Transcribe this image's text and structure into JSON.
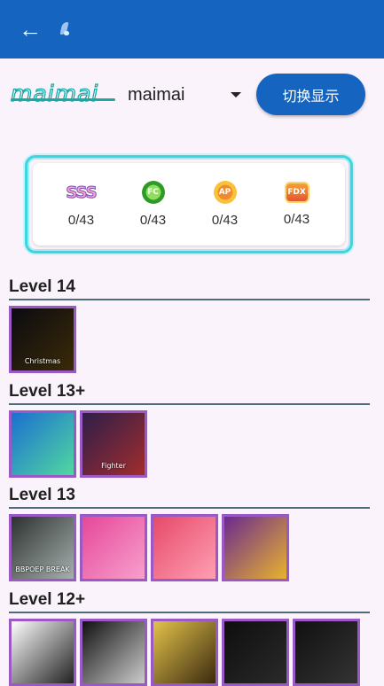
{
  "app_bar": {
    "back_icon": "arrow-left-icon",
    "app_icon": "app-logo-icon",
    "color": "#1565c0"
  },
  "header": {
    "logo_text": "maimai",
    "game_select_value": "maimai",
    "switch_button_label": "切换显示"
  },
  "stats": [
    {
      "badge": "SSS",
      "count": "0/43"
    },
    {
      "badge": "FC",
      "count": "0/43"
    },
    {
      "badge": "AP",
      "count": "0/43"
    },
    {
      "badge": "FDX",
      "count": "0/43"
    }
  ],
  "levels": [
    {
      "title": "Level 14",
      "covers": [
        {
          "label": "Christmas",
          "colors": [
            "#0b0b10",
            "#3a2a08"
          ]
        }
      ]
    },
    {
      "title": "Level 13+",
      "covers": [
        {
          "label": "",
          "colors": [
            "#1b6fd1",
            "#51d8a0"
          ]
        },
        {
          "label": "Fighter",
          "colors": [
            "#2e1e4a",
            "#a12d2d"
          ]
        }
      ]
    },
    {
      "title": "Level 13",
      "covers": [
        {
          "label": "BBPOEP BREAK",
          "colors": [
            "#2d3230",
            "#a6b0ae"
          ]
        },
        {
          "label": "",
          "colors": [
            "#e6479a",
            "#f7a0cc"
          ]
        },
        {
          "label": "",
          "colors": [
            "#e64a6a",
            "#ff9fb3"
          ]
        },
        {
          "label": "",
          "colors": [
            "#6b2a8f",
            "#e8b22e"
          ]
        }
      ]
    },
    {
      "title": "Level 12+",
      "covers": [
        {
          "label": "",
          "colors": [
            "#ffffff",
            "#222222"
          ]
        },
        {
          "label": "",
          "colors": [
            "#111111",
            "#cccccc"
          ]
        },
        {
          "label": "",
          "colors": [
            "#e3c24a",
            "#3a2a10"
          ]
        },
        {
          "label": "",
          "colors": [
            "#0e0e0e",
            "#2a2a2a"
          ]
        },
        {
          "label": "",
          "colors": [
            "#111111",
            "#333333"
          ]
        }
      ]
    }
  ]
}
